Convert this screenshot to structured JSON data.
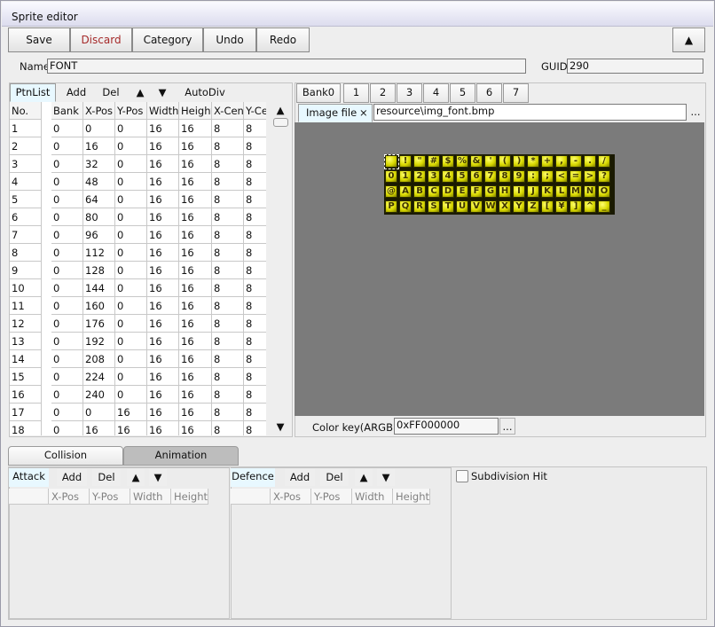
{
  "window": {
    "title": "Sprite editor"
  },
  "toolbar": {
    "save": "Save",
    "discard": "Discard",
    "category": "Category",
    "undo": "Undo",
    "redo": "Redo",
    "collapse": "▲"
  },
  "discard_color": "#a52a2a",
  "name": {
    "label": "Name",
    "value": "FONT"
  },
  "guid": {
    "label": "GUID",
    "value": "290"
  },
  "ptn": {
    "tab": "PtnList",
    "add": "Add",
    "del": "Del",
    "up": "▲",
    "down": "▼",
    "autodiv": "AutoDiv",
    "scroll_up": "▲",
    "scroll_down": "▼",
    "columns": [
      "No.",
      "Bank",
      "X-Pos",
      "Y-Pos",
      "Width",
      "Height",
      "X-Cen",
      "Y-Cen"
    ],
    "rows": [
      [
        "1",
        "0",
        "0",
        "0",
        "16",
        "16",
        "8",
        "8"
      ],
      [
        "2",
        "0",
        "16",
        "0",
        "16",
        "16",
        "8",
        "8"
      ],
      [
        "3",
        "0",
        "32",
        "0",
        "16",
        "16",
        "8",
        "8"
      ],
      [
        "4",
        "0",
        "48",
        "0",
        "16",
        "16",
        "8",
        "8"
      ],
      [
        "5",
        "0",
        "64",
        "0",
        "16",
        "16",
        "8",
        "8"
      ],
      [
        "6",
        "0",
        "80",
        "0",
        "16",
        "16",
        "8",
        "8"
      ],
      [
        "7",
        "0",
        "96",
        "0",
        "16",
        "16",
        "8",
        "8"
      ],
      [
        "8",
        "0",
        "112",
        "0",
        "16",
        "16",
        "8",
        "8"
      ],
      [
        "9",
        "0",
        "128",
        "0",
        "16",
        "16",
        "8",
        "8"
      ],
      [
        "10",
        "0",
        "144",
        "0",
        "16",
        "16",
        "8",
        "8"
      ],
      [
        "11",
        "0",
        "160",
        "0",
        "16",
        "16",
        "8",
        "8"
      ],
      [
        "12",
        "0",
        "176",
        "0",
        "16",
        "16",
        "8",
        "8"
      ],
      [
        "13",
        "0",
        "192",
        "0",
        "16",
        "16",
        "8",
        "8"
      ],
      [
        "14",
        "0",
        "208",
        "0",
        "16",
        "16",
        "8",
        "8"
      ],
      [
        "15",
        "0",
        "224",
        "0",
        "16",
        "16",
        "8",
        "8"
      ],
      [
        "16",
        "0",
        "240",
        "0",
        "16",
        "16",
        "8",
        "8"
      ],
      [
        "17",
        "0",
        "0",
        "16",
        "16",
        "16",
        "8",
        "8"
      ],
      [
        "18",
        "0",
        "16",
        "16",
        "16",
        "16",
        "8",
        "8"
      ]
    ]
  },
  "banks": [
    "Bank0",
    "1",
    "2",
    "3",
    "4",
    "5",
    "6",
    "7"
  ],
  "image": {
    "tab": "Image file",
    "close": "×",
    "path": "resource\\img_font.bmp",
    "browse": "..."
  },
  "font_sheet": [
    "",
    "!",
    "\"",
    "#",
    "$",
    "%",
    "&",
    "'",
    "(",
    ")",
    "*",
    "+",
    ",",
    "-",
    ".",
    "/",
    "0",
    "1",
    "2",
    "3",
    "4",
    "5",
    "6",
    "7",
    "8",
    "9",
    ":",
    ";",
    "<",
    "=",
    ">",
    "?",
    "@",
    "A",
    "B",
    "C",
    "D",
    "E",
    "F",
    "G",
    "H",
    "I",
    "J",
    "K",
    "L",
    "M",
    "N",
    "O",
    "P",
    "Q",
    "R",
    "S",
    "T",
    "U",
    "V",
    "W",
    "X",
    "Y",
    "Z",
    "[",
    "¥",
    "]",
    "^",
    "_"
  ],
  "colorkey": {
    "label": "Color key(ARGB)",
    "value": "0xFF000000",
    "browse": "..."
  },
  "bottom_tabs": {
    "collision": "Collision",
    "animation": "Animation"
  },
  "attack": {
    "tab": "Attack",
    "add": "Add",
    "del": "Del",
    "up": "▲",
    "down": "▼",
    "columns": [
      "",
      "X-Pos",
      "Y-Pos",
      "Width",
      "Height"
    ]
  },
  "defence": {
    "tab": "Defence",
    "add": "Add",
    "del": "Del",
    "up": "▲",
    "down": "▼",
    "columns": [
      "",
      "X-Pos",
      "Y-Pos",
      "Width",
      "Height"
    ]
  },
  "subdivision": {
    "label": "Subdivision Hit",
    "checked": false
  }
}
